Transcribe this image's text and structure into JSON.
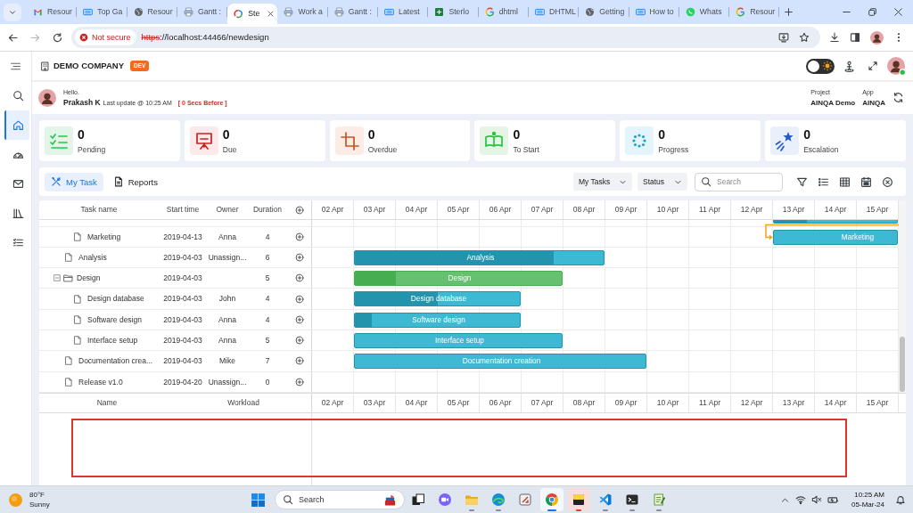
{
  "browser": {
    "tabs": [
      {
        "title": "Resour",
        "selected": false
      },
      {
        "title": "Top Ga",
        "selected": false
      },
      {
        "title": "Resour",
        "selected": false
      },
      {
        "title": "Gantt :",
        "selected": false
      },
      {
        "title": "Ste",
        "selected": true
      },
      {
        "title": "Work a",
        "selected": false
      },
      {
        "title": "Gantt :",
        "selected": false
      },
      {
        "title": "Latest",
        "selected": false
      },
      {
        "title": "Sterlo",
        "selected": false
      },
      {
        "title": "dhtml",
        "selected": false
      },
      {
        "title": "DHTML",
        "selected": false
      },
      {
        "title": "Getting",
        "selected": false
      },
      {
        "title": "How to",
        "selected": false
      },
      {
        "title": "Whats",
        "selected": false
      },
      {
        "title": "Resour",
        "selected": false
      }
    ],
    "nav": [
      {
        "disabled": false
      },
      {
        "disabled": true
      },
      {
        "disabled": false
      }
    ],
    "address": {
      "security": "Not secure",
      "scheme": "https",
      "rest": "://localhost:44466/newdesign"
    }
  },
  "header": {
    "company": "DEMO COMPANY",
    "badge": "DEV",
    "theme_toggle": {
      "on": false
    }
  },
  "user": {
    "greeting": "Hello.",
    "name": "Prakash K",
    "last_update": "Last update @ 10:25 AM",
    "elapsed": "[ 0 Secs Before ]",
    "project_label": "Project",
    "project": "AINQA Demo",
    "app_label": "App",
    "app": "AINQA"
  },
  "sidebar": {
    "items": [
      {
        "selected": false
      },
      {
        "selected": true
      },
      {
        "selected": false
      },
      {
        "selected": false
      },
      {
        "selected": false
      },
      {
        "selected": false
      }
    ]
  },
  "stats": [
    {
      "count": "0",
      "label": "Pending",
      "color": "#e3f4e8"
    },
    {
      "count": "0",
      "label": "Due",
      "color": "#fce9e9"
    },
    {
      "count": "0",
      "label": "Overdue",
      "color": "#fdece5"
    },
    {
      "count": "0",
      "label": "To Start",
      "color": "#e5f4e7"
    },
    {
      "count": "0",
      "label": "Progress",
      "color": "#e3f5fb"
    },
    {
      "count": "0",
      "label": "Escalation",
      "color": "#e9effb"
    }
  ],
  "toolbar": {
    "tabs": [
      {
        "label": "My Task",
        "selected": true
      },
      {
        "label": "Reports",
        "selected": false
      }
    ],
    "dropdowns": [
      {
        "value": "My Tasks"
      },
      {
        "value": "Status"
      }
    ],
    "search": {
      "placeholder": "Search"
    }
  },
  "gantt": {
    "columns": [
      "Task name",
      "Start time",
      "Owner",
      "Duration"
    ],
    "dates": [
      "02 Apr",
      "03 Apr",
      "04 Apr",
      "05 Apr",
      "06 Apr",
      "07 Apr",
      "08 Apr",
      "09 Apr",
      "10 Apr",
      "11 Apr",
      "12 Apr",
      "13 Apr",
      "14 Apr",
      "15 Apr"
    ],
    "tasks": [
      {
        "kind": "hidden",
        "children": [
          {
            "kind": "clipped",
            "level": 0.27
          },
          {
            "kind": "task",
            "name": "Marketing",
            "start": "2019-04-13",
            "owner": "Anna",
            "duration": "4",
            "bar_label": "Marketing",
            "linked": true
          }
        ]
      },
      {
        "kind": "task",
        "name": "Analysis",
        "start": "2019-04-03",
        "owner": "Unassign...",
        "duration": "6",
        "bar_label": "Analysis",
        "level": 0.8,
        "linked": false
      },
      {
        "kind": "project",
        "name": "Design",
        "start": "2019-04-03",
        "duration": "5",
        "bar_label": "Design",
        "level": 0.2,
        "linked": false,
        "expanded": true,
        "children": [
          {
            "kind": "task",
            "name": "Design database",
            "start": "2019-04-03",
            "owner": "John",
            "duration": "4",
            "bar_label": "Design database",
            "level": 0.5,
            "linked": false
          },
          {
            "kind": "task",
            "name": "Software design",
            "start": "2019-04-03",
            "owner": "Anna",
            "duration": "4",
            "bar_label": "Software design",
            "level": 0.1,
            "linked": false
          },
          {
            "kind": "task",
            "name": "Interface setup",
            "start": "2019-04-03",
            "owner": "Anna",
            "duration": "5",
            "bar_label": "Interface setup",
            "linked": false
          }
        ]
      },
      {
        "kind": "task",
        "name": "Documentation crea...",
        "start": "2019-04-03",
        "owner": "Mike",
        "duration": "7",
        "bar_label": "Documentation creation",
        "linked": false
      },
      {
        "kind": "task",
        "name": "Release v1.0",
        "start": "2019-04-20",
        "owner": "Unassign...",
        "duration": "0",
        "linked": false
      }
    ],
    "resource_columns": [
      "Name",
      "Workload"
    ],
    "resource_dates": [
      "02 Apr",
      "03 Apr",
      "04 Apr",
      "05 Apr",
      "06 Apr",
      "07 Apr",
      "08 Apr",
      "09 Apr",
      "10 Apr",
      "11 Apr",
      "12 Apr",
      "13 Apr",
      "14 Apr",
      "15 Apr"
    ]
  },
  "taskbar": {
    "weather": {
      "temperature": "80°F",
      "condition": "Sunny"
    },
    "search": {
      "placeholder": "Search"
    },
    "apps": [
      {
        "running": false,
        "selected": false,
        "alert": false
      },
      {
        "running": false,
        "selected": false,
        "alert": false
      },
      {
        "running": true,
        "selected": false,
        "alert": false
      },
      {
        "running": true,
        "selected": false,
        "alert": false
      },
      {
        "running": false,
        "selected": false,
        "alert": false
      },
      {
        "running": true,
        "selected": true,
        "alert": false
      },
      {
        "running": true,
        "selected": false,
        "alert": true
      },
      {
        "running": true,
        "selected": false,
        "alert": false
      },
      {
        "running": true,
        "selected": false,
        "alert": false
      },
      {
        "running": true,
        "selected": false,
        "alert": false
      }
    ],
    "clock": {
      "time": "10:25 AM",
      "date": "05-Mar-24"
    }
  }
}
